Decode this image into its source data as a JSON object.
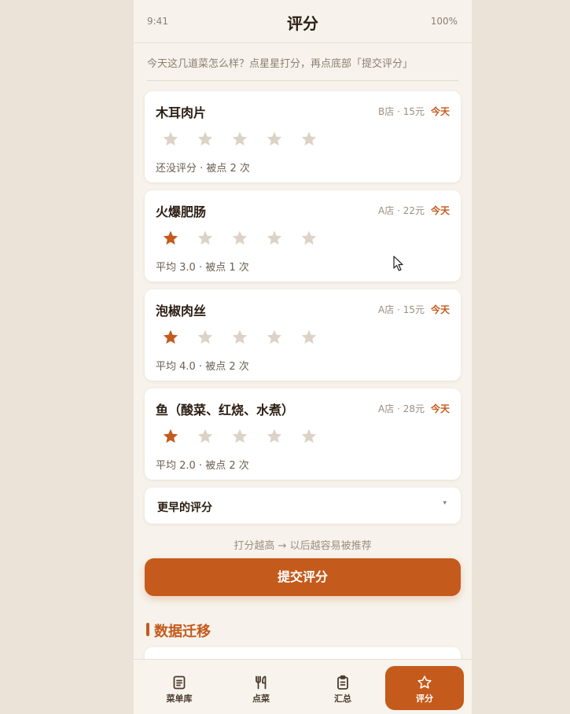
{
  "status": {
    "time": "9:41",
    "battery": "100%"
  },
  "header": {
    "title": "评分"
  },
  "hint": "今天这几道菜怎么样？点星星打分，再点底部「提交评分」",
  "dishes": [
    {
      "name": "木耳肉片",
      "meta": "B店 · 15元",
      "badge": "今天",
      "rating": 0,
      "stats": "还没评分 · 被点 2 次"
    },
    {
      "name": "火爆肥肠",
      "meta": "A店 · 22元",
      "badge": "今天",
      "rating": 1,
      "stats": "平均 3.0 · 被点 1 次"
    },
    {
      "name": "泡椒肉丝",
      "meta": "A店 · 15元",
      "badge": "今天",
      "rating": 1,
      "stats": "平均 4.0 · 被点 2 次"
    },
    {
      "name": "鱼（酸菜、红烧、水煮）",
      "meta": "A店 · 28元",
      "badge": "今天",
      "rating": 1,
      "stats": "平均 2.0 · 被点 2 次"
    }
  ],
  "earlier": {
    "label": "更早的评分",
    "caret": "▾"
  },
  "submit": {
    "hint": "打分越高 → 以后越容易被推荐",
    "label": "提交评分"
  },
  "migration": {
    "title": "数据迁移"
  },
  "tabs": [
    {
      "label": "菜单库",
      "icon": "menu-list-icon",
      "active": false
    },
    {
      "label": "点菜",
      "icon": "fork-knife-icon",
      "active": false
    },
    {
      "label": "汇总",
      "icon": "clipboard-icon",
      "active": false
    },
    {
      "label": "评分",
      "icon": "star-icon",
      "active": true
    }
  ],
  "colors": {
    "accent": "#c45a1c",
    "star_empty": "#dcd2c6",
    "background": "#f7f3ec"
  }
}
